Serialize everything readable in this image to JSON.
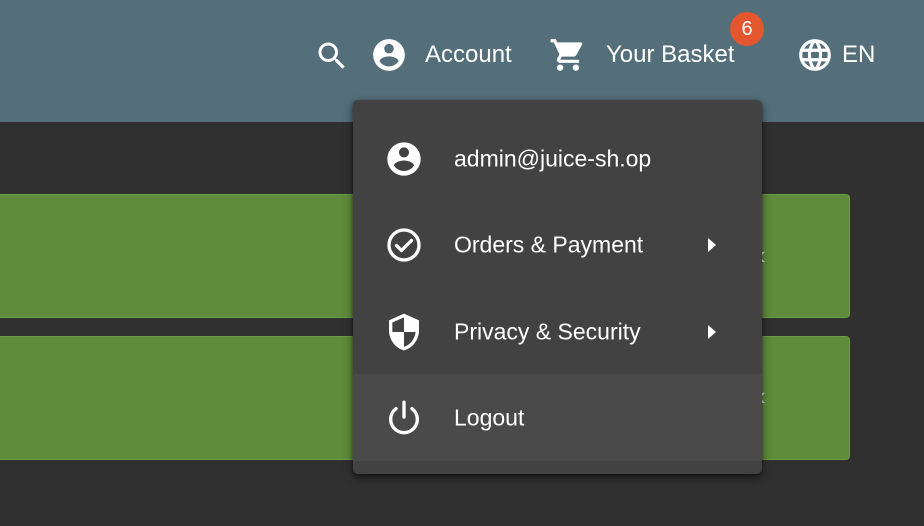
{
  "header": {
    "search_icon": "search-icon",
    "account_label": "Account",
    "basket_label": "Your Basket",
    "basket_count": "6",
    "language_label": "EN",
    "colors": {
      "toolbar": "#546e7a",
      "badge": "#e4572e"
    }
  },
  "account_menu": {
    "items": [
      {
        "icon": "account-circle-icon",
        "label": "admin@juice-sh.op",
        "has_submenu": false
      },
      {
        "icon": "check-circle-icon",
        "label": "Orders & Payment",
        "has_submenu": true
      },
      {
        "icon": "shield-icon",
        "label": "Privacy & Security",
        "has_submenu": true
      },
      {
        "icon": "power-icon",
        "label": "Logout",
        "has_submenu": false
      }
    ]
  },
  "background_cards": {
    "color": "#5f8b3b",
    "chevron": "‹"
  }
}
